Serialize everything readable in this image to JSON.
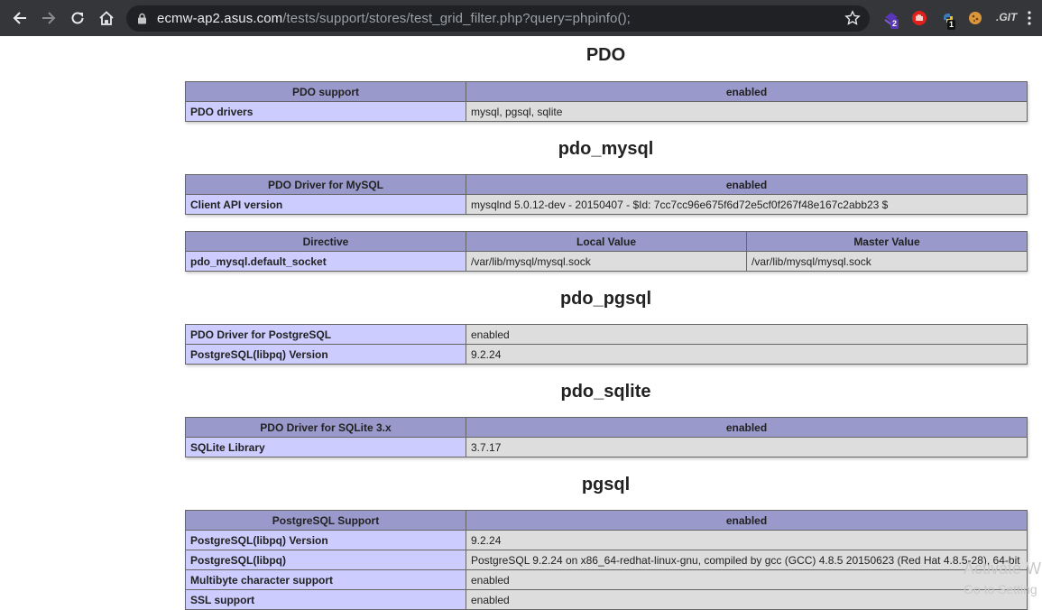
{
  "browser": {
    "url_host": "ecmw-ap2.asus.com",
    "url_path": "/tests/support/stores/test_grid_filter.php?query=phpinfo();",
    "extensions": [
      {
        "name": "ext-stack-icon",
        "badge": "2"
      },
      {
        "name": "ext-hand-icon",
        "badge": ""
      },
      {
        "name": "ext-python-icon",
        "badge": "1"
      },
      {
        "name": "ext-cookie-icon",
        "badge": ""
      }
    ],
    "git_label": ".GIT"
  },
  "pdo": {
    "heading": "PDO",
    "header": [
      "PDO support",
      "enabled"
    ],
    "rows": [
      [
        "PDO drivers",
        "mysql, pgsql, sqlite"
      ]
    ]
  },
  "pdo_mysql": {
    "heading": "pdo_mysql",
    "header": [
      "PDO Driver for MySQL",
      "enabled"
    ],
    "rows": [
      [
        "Client API version",
        "mysqlnd 5.0.12-dev - 20150407 - $Id: 7cc7cc96e675f6d72e5cf0f267f48e167c2abb23 $"
      ]
    ],
    "directive_header": [
      "Directive",
      "Local Value",
      "Master Value"
    ],
    "directive_rows": [
      [
        "pdo_mysql.default_socket",
        "/var/lib/mysql/mysql.sock",
        "/var/lib/mysql/mysql.sock"
      ]
    ]
  },
  "pdo_pgsql": {
    "heading": "pdo_pgsql",
    "rows": [
      [
        "PDO Driver for PostgreSQL",
        "enabled"
      ],
      [
        "PostgreSQL(libpq) Version",
        "9.2.24"
      ]
    ]
  },
  "pdo_sqlite": {
    "heading": "pdo_sqlite",
    "header": [
      "PDO Driver for SQLite 3.x",
      "enabled"
    ],
    "rows": [
      [
        "SQLite Library",
        "3.7.17"
      ]
    ]
  },
  "pgsql": {
    "heading": "pgsql",
    "header": [
      "PostgreSQL Support",
      "enabled"
    ],
    "rows": [
      [
        "PostgreSQL(libpq) Version",
        "9.2.24"
      ],
      [
        "PostgreSQL(libpq)",
        "PostgreSQL 9.2.24 on x86_64-redhat-linux-gnu, compiled by gcc (GCC) 4.8.5 20150623 (Red Hat 4.8.5-28), 64-bit"
      ],
      [
        "Multibyte character support",
        "enabled"
      ],
      [
        "SSL support",
        "enabled"
      ]
    ]
  },
  "watermark": {
    "line1": "Activate W",
    "line2": "Go to Setting"
  }
}
